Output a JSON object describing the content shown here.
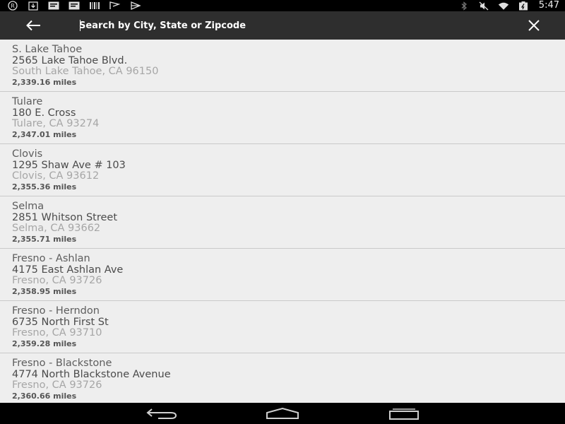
{
  "status_bar": {
    "time": "5:47",
    "left_icons": [
      "registered-icon",
      "download-icon",
      "notification-card-icon",
      "notification-card-icon",
      "barcode-icon",
      "flag-icon",
      "play-icon"
    ],
    "right_icons": [
      "bluetooth-icon",
      "mute-icon",
      "wifi-icon",
      "battery-icon"
    ]
  },
  "action_bar": {
    "search_placeholder": "Search by City, State or Zipcode",
    "back_icon": "arrow-left-icon",
    "clear_icon": "close-icon"
  },
  "locations": [
    {
      "name": "S. Lake Tahoe",
      "street": "2565 Lake Tahoe Blvd.",
      "city_line": "South Lake Tahoe, CA 96150",
      "distance": "2,339.16 miles"
    },
    {
      "name": "Tulare",
      "street": "180 E. Cross",
      "city_line": "Tulare, CA 93274",
      "distance": "2,347.01 miles"
    },
    {
      "name": "Clovis",
      "street": "1295 Shaw Ave # 103",
      "city_line": "Clovis, CA 93612",
      "distance": "2,355.36 miles"
    },
    {
      "name": "Selma",
      "street": "2851 Whitson Street",
      "city_line": "Selma, CA 93662",
      "distance": "2,355.71 miles"
    },
    {
      "name": "Fresno - Ashlan",
      "street": "4175 East Ashlan Ave",
      "city_line": "Fresno, CA 93726",
      "distance": "2,358.95 miles"
    },
    {
      "name": "Fresno - Herndon",
      "street": "6735 North First St",
      "city_line": "Fresno, CA 93710",
      "distance": "2,359.28 miles"
    },
    {
      "name": "Fresno - Blackstone",
      "street": "4774 North Blackstone Avenue",
      "city_line": "Fresno, CA 93726",
      "distance": "2,360.66 miles"
    }
  ],
  "nav_bar": {
    "icons": [
      "back-nav-icon",
      "home-nav-icon",
      "recent-apps-icon"
    ]
  },
  "colors": {
    "status_bar": "#000000",
    "action_bar": "#2e2e2e",
    "list_background": "#eeeeee",
    "divider": "#c9c9c9",
    "nav_bar": "#000000"
  }
}
